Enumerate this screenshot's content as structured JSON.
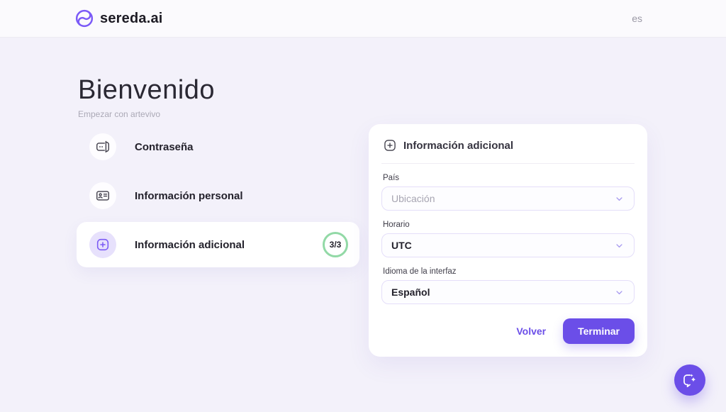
{
  "header": {
    "brand": "sereda.ai",
    "language": "es"
  },
  "hero": {
    "title": "Bienvenido",
    "subtitle": "Empezar con artevivo"
  },
  "steps": [
    {
      "label": "Contraseña",
      "icon": "password-input-icon"
    },
    {
      "label": "Información personal",
      "icon": "id-card-icon"
    },
    {
      "label": "Información adicional",
      "icon": "plus-square-icon",
      "badge": "3/3",
      "active": true
    }
  ],
  "panel": {
    "title": "Información adicional",
    "icon": "plus-square-icon",
    "fields": [
      {
        "label": "País",
        "value": "Ubicación",
        "is_placeholder": true
      },
      {
        "label": "Horario",
        "value": "UTC",
        "is_placeholder": false
      },
      {
        "label": "Idioma de la interfaz",
        "value": "Español",
        "is_placeholder": false
      }
    ],
    "buttons": {
      "back": "Volver",
      "finish": "Terminar"
    }
  },
  "fab": {
    "icon": "chat-sparkles-icon"
  },
  "colors": {
    "accent": "#6B4EE8",
    "logo": "#7B5AF7",
    "badge_ring": "#92D9A6",
    "page_bg": "#F3F1FA",
    "header_bg": "#FBFAFD"
  }
}
